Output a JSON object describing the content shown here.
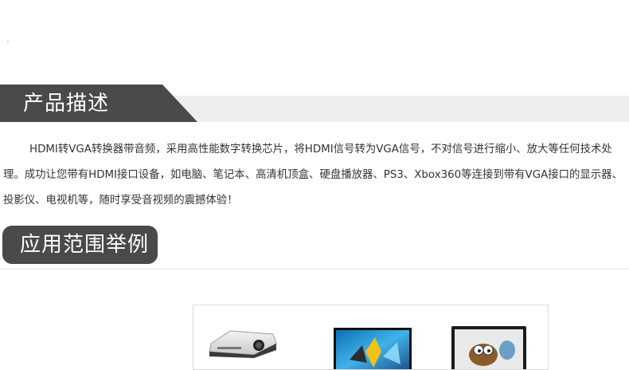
{
  "section_product": {
    "title": "产品描述",
    "description": "HDMI转VGA转换器带音频，采用高性能数字转换芯片，将HDMI信号转为VGA信号，不对信号进行缩小、放大等任何技术处理。成功让您带有HDMI接口设备，如电脑、笔记本、高清机顶盒、硬盘播放器、PS3、Xbox360等连接到带有VGA接口的显示器、投影仪、电视机等，随时享受音视频的震撼体验！"
  },
  "section_application": {
    "title": "应用范围举例",
    "items": [
      {
        "icon": "projector-icon"
      },
      {
        "icon": "monitor-game-icon"
      },
      {
        "icon": "tv-cartoon-icon"
      }
    ]
  },
  "colors": {
    "banner_dark": "#4a4a4a",
    "banner_light": "#ededed",
    "text": "#333333"
  }
}
